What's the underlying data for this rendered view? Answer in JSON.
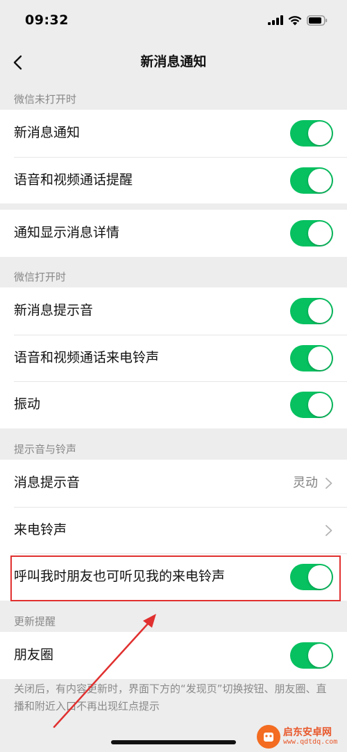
{
  "status_bar": {
    "time": "09:32"
  },
  "nav": {
    "title": "新消息通知"
  },
  "sections": [
    {
      "header": "微信未打开时",
      "rows": [
        {
          "label": "新消息通知",
          "control": "toggle",
          "on": true
        },
        {
          "label": "语音和视频通话提醒",
          "control": "toggle",
          "on": true
        }
      ]
    },
    {
      "header": "",
      "rows": [
        {
          "label": "通知显示消息详情",
          "control": "toggle",
          "on": true
        }
      ]
    },
    {
      "header": "微信打开时",
      "rows": [
        {
          "label": "新消息提示音",
          "control": "toggle",
          "on": true
        },
        {
          "label": "语音和视频通话来电铃声",
          "control": "toggle",
          "on": true
        },
        {
          "label": "振动",
          "control": "toggle",
          "on": true
        }
      ]
    },
    {
      "header": "提示音与铃声",
      "rows": [
        {
          "label": "消息提示音",
          "control": "chevron",
          "value": "灵动"
        },
        {
          "label": "来电铃声",
          "control": "chevron",
          "value": ""
        },
        {
          "label": "呼叫我时朋友也可听见我的来电铃声",
          "control": "toggle",
          "on": true
        }
      ]
    },
    {
      "header": "更新提醒",
      "rows": [
        {
          "label": "朋友圈",
          "control": "toggle",
          "on": true
        }
      ]
    }
  ],
  "footer_note": "关闭后，有内容更新时，界面下方的“发现页”切换按钮、朋友圈、直播和附近入口不再出现红点提示",
  "watermark": {
    "name": "启东安卓网",
    "url": "www.qdtdq.com"
  },
  "colors": {
    "toggle_on": "#07c160",
    "highlight": "#e0302f",
    "background": "#ededed"
  }
}
